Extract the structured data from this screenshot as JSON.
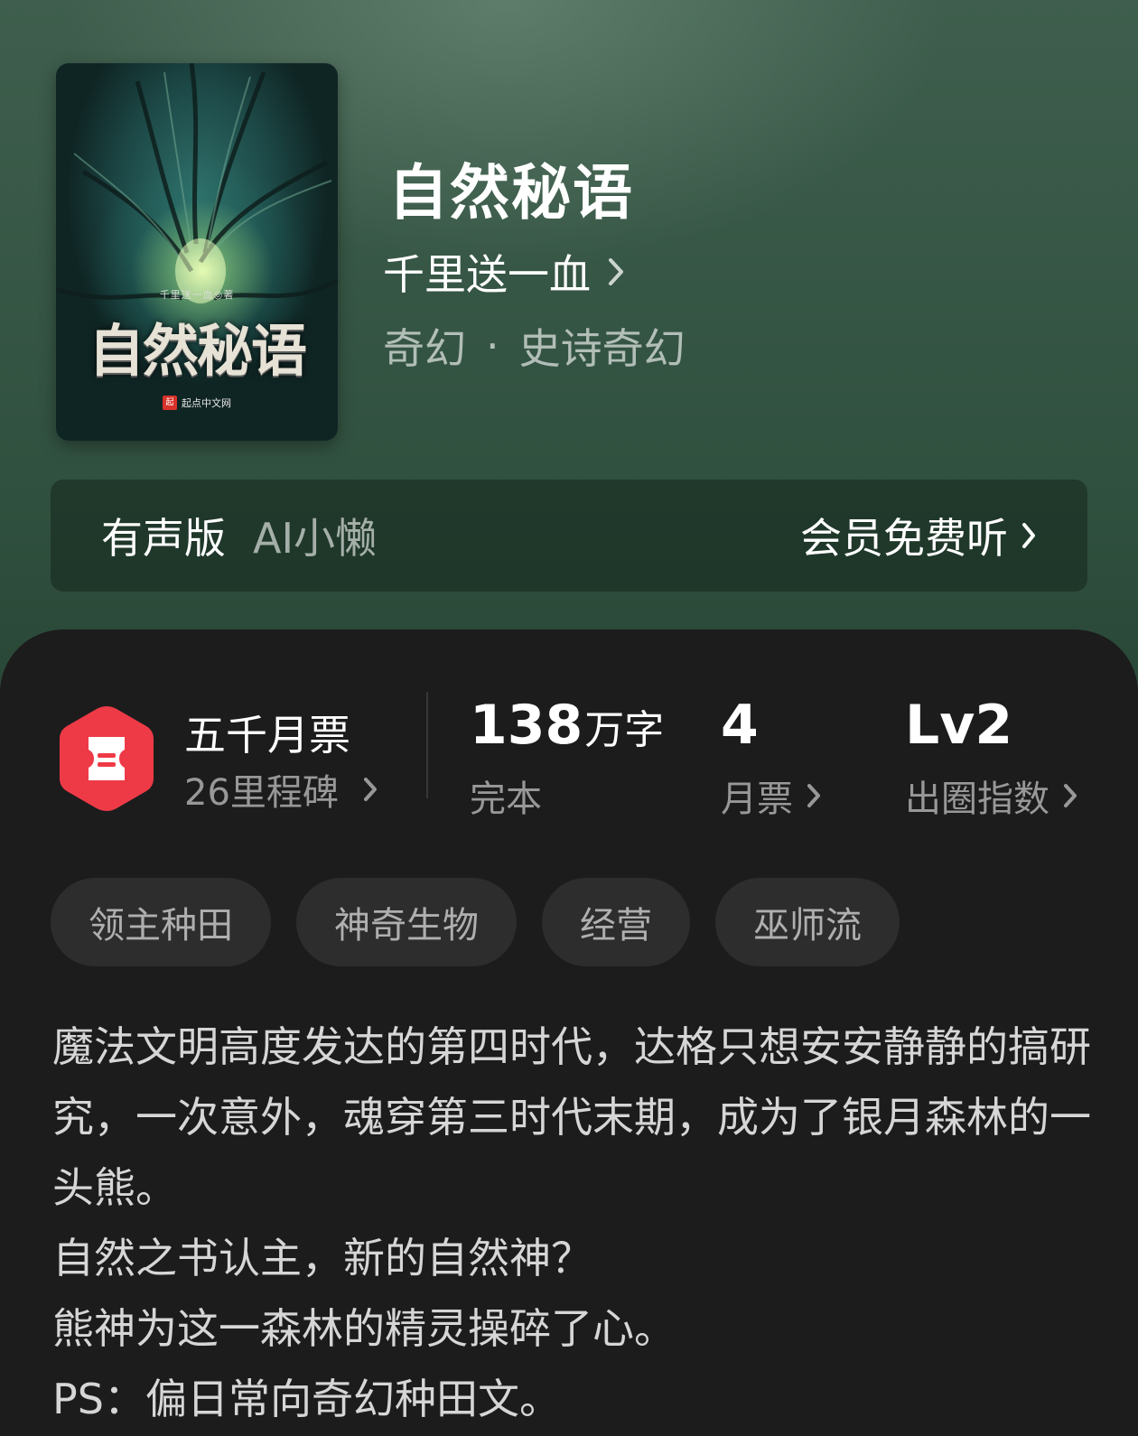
{
  "book": {
    "title": "自然秘语",
    "author": "千里送一血",
    "genre": "奇幻",
    "subgenre": "史诗奇幻",
    "genre_separator": "·"
  },
  "cover": {
    "author_text": "千里送一血◎著",
    "title_text": "自然秘语",
    "publisher": "起点中文网",
    "publisher_logo": "起"
  },
  "audio": {
    "label": "有声版",
    "narrator": "AI小懒",
    "cta": "会员免费听"
  },
  "stats": {
    "ticket_title": "五千月票",
    "ticket_sub": "26里程碑",
    "words_value": "138",
    "words_unit": "万字",
    "words_status": "完本",
    "monthly_value": "4",
    "monthly_label": "月票",
    "level_value": "Lv2",
    "level_label": "出圈指数"
  },
  "tags": [
    "领主种田",
    "神奇生物",
    "经营",
    "巫师流"
  ],
  "synopsis": [
    "魔法文明高度发达的第四时代，达格只想安安静静的搞研究，一次意外，魂穿第三时代末期，成为了银月森林的一头熊。",
    "自然之书认主，新的自然神？",
    "熊神为这一森林的精灵操碎了心。",
    "PS：偏日常向奇幻种田文。"
  ],
  "colors": {
    "badge_red": "#ee3a47",
    "card_bg": "#1c1c1c",
    "tag_bg": "#2d2d2d"
  },
  "icons": {
    "chevron": "chevron-right-icon",
    "ticket": "ticket-icon"
  }
}
